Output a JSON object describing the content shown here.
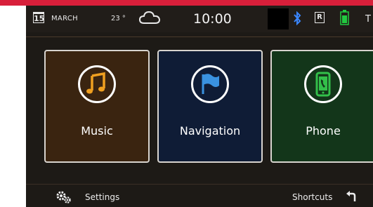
{
  "status_bar": {
    "date_day": "15",
    "month": "MARCH",
    "temperature": "23 °",
    "weather_icon": "cloud-icon",
    "time": "10:00",
    "icons": [
      "bluetooth-icon",
      "r-icon",
      "battery-icon"
    ],
    "r_label": "R",
    "partial_label": "T"
  },
  "tiles": [
    {
      "label": "Music",
      "icon": "music-note-icon",
      "color": "#3a2410",
      "accent": "#f0a020"
    },
    {
      "label": "Navigation",
      "icon": "flag-icon",
      "color": "#0f1c36",
      "accent": "#3a92e0"
    },
    {
      "label": "Phone",
      "icon": "phone-icon",
      "color": "#13361a",
      "accent": "#33c04a"
    }
  ],
  "bottom_bar": {
    "settings_label": "Settings",
    "shortcuts_label": "Shortcuts"
  },
  "colors": {
    "brand_red": "#d81f3a",
    "screen_bg": "#1d1a16",
    "bluetooth": "#3a86ff",
    "battery": "#22c940"
  }
}
